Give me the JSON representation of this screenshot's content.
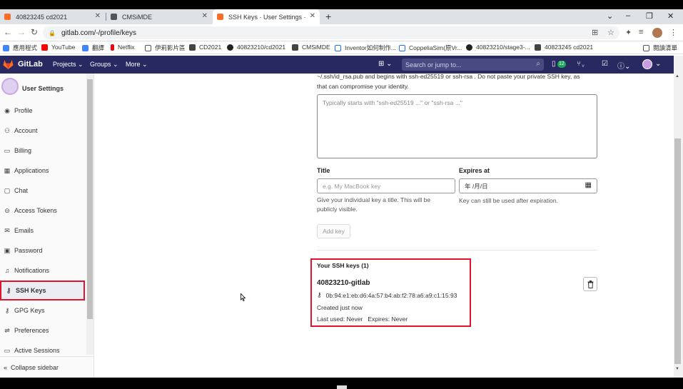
{
  "browser": {
    "tabs": [
      {
        "title": "40823245 cd2021"
      },
      {
        "title": "CMSiMDE"
      },
      {
        "title": "SSH Keys · User Settings · GitLab"
      }
    ],
    "url": "gitlab.com/-/profile/keys",
    "bookmarks": [
      "應用程式",
      "YouTube",
      "翻譯",
      "Netflix",
      "伊莉影片區",
      "CD2021",
      "40823210/cd2021",
      "CMSiMDE",
      "Inventor如何制作...",
      "CoppeliaSim(原Vr...",
      "40823210/stage3-...",
      "40823245 cd2021"
    ],
    "reading_list": "閱讀清單"
  },
  "gitlab": {
    "brand": "GitLab",
    "menus": [
      "Projects",
      "Groups",
      "More"
    ],
    "search_placeholder": "Search or jump to...",
    "mr_count": "12"
  },
  "sidebar": {
    "title": "User Settings",
    "items": [
      {
        "label": "Profile",
        "icon": "profile-icon"
      },
      {
        "label": "Account",
        "icon": "account-icon"
      },
      {
        "label": "Billing",
        "icon": "billing-icon"
      },
      {
        "label": "Applications",
        "icon": "applications-icon"
      },
      {
        "label": "Chat",
        "icon": "chat-icon"
      },
      {
        "label": "Access Tokens",
        "icon": "token-icon"
      },
      {
        "label": "Emails",
        "icon": "email-icon"
      },
      {
        "label": "Password",
        "icon": "lock-icon"
      },
      {
        "label": "Notifications",
        "icon": "bell-icon"
      },
      {
        "label": "SSH Keys",
        "icon": "key-icon",
        "active": true
      },
      {
        "label": "GPG Keys",
        "icon": "key-icon"
      },
      {
        "label": "Preferences",
        "icon": "preferences-icon"
      },
      {
        "label": "Active Sessions",
        "icon": "sessions-icon"
      }
    ],
    "collapse_label": "Collapse sidebar"
  },
  "form": {
    "desc_line1": "~/.ssh/id_rsa.pub  and begins with  ssh-ed25519  or  ssh-rsa . Do not paste your private SSH key, as",
    "desc_line2": "that can compromise your identity.",
    "key_placeholder": "Typically starts with \"ssh-ed25519 ...\" or \"ssh-rsa ...\"",
    "title_label": "Title",
    "title_placeholder": "e.g. My MacBook key",
    "title_help_1": "Give your individual key a title. This will be",
    "title_help_2": "publicly visible.",
    "expires_label": "Expires at",
    "expires_placeholder": "年 /月/日",
    "expires_help": "Key can still be used after expiration.",
    "add_button": "Add key"
  },
  "keys": {
    "heading": "Your SSH keys (1)",
    "items": [
      {
        "title": "40823210-gitlab",
        "fingerprint": "0b:94:e1:eb:d6:4a:57:b4:ab:f2:78:a6:a9:c1:15:93",
        "created": "Created just now",
        "last_used": "Last used: Never",
        "expires": "Expires: Never"
      }
    ]
  },
  "colors": {
    "nav_bg": "#292961",
    "highlight": "#e0142d",
    "badge": "#1aaa55"
  }
}
